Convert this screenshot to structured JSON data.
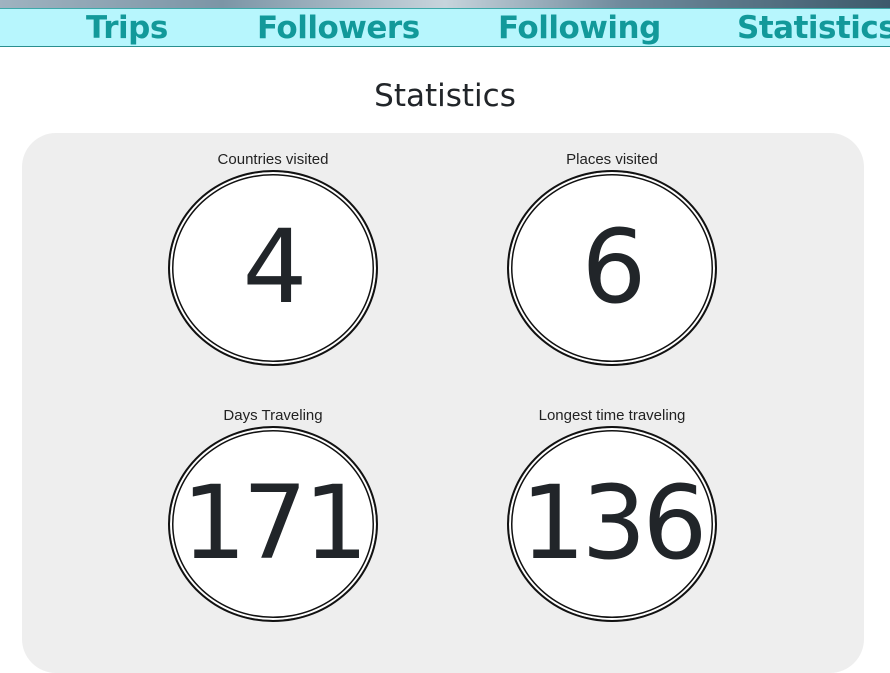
{
  "nav": {
    "tabs": [
      {
        "label": "Trips"
      },
      {
        "label": "Followers"
      },
      {
        "label": "Following"
      },
      {
        "label": "Statistics"
      }
    ]
  },
  "page": {
    "title": "Statistics"
  },
  "stats": [
    {
      "label": "Countries visited",
      "value": "4"
    },
    {
      "label": "Places visited",
      "value": "6"
    },
    {
      "label": "Days Traveling",
      "value": "171"
    },
    {
      "label": "Longest time traveling",
      "value": "136"
    }
  ],
  "colors": {
    "nav_background": "#b7f6fd",
    "nav_text": "#12999a",
    "panel_background": "#eeeeee",
    "text": "#212529"
  }
}
